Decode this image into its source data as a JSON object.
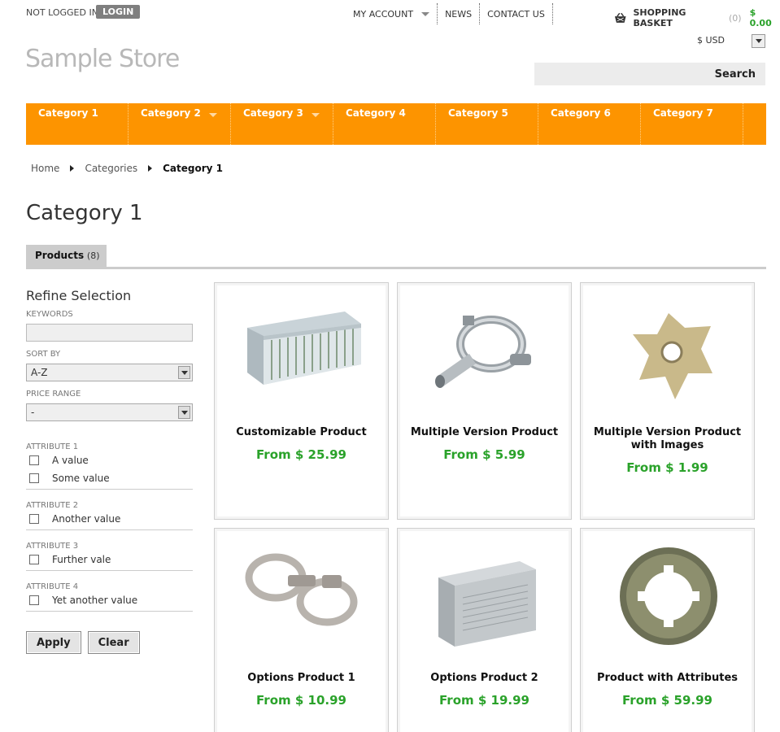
{
  "header": {
    "login_status": "NOT LOGGED IN",
    "login_label": "LOGIN",
    "nav": [
      {
        "label": "MY ACCOUNT"
      },
      {
        "label": "NEWS"
      },
      {
        "label": "CONTACT US"
      }
    ],
    "basket_label": "SHOPPING BASKET",
    "basket_count": "(0)",
    "basket_total": "$ 0.00",
    "currency": "$ USD",
    "logo": "Sample Store",
    "search_label": "Search"
  },
  "categories": [
    "Category 1",
    "Category 2",
    "Category 3",
    "Category 4",
    "Category 5",
    "Category 6",
    "Category 7"
  ],
  "breadcrumb": {
    "home": "Home",
    "categories": "Categories",
    "current": "Category 1"
  },
  "page_title": "Category 1",
  "tab": {
    "label": "Products",
    "count": "(8)"
  },
  "refine": {
    "title": "Refine Selection",
    "keywords_label": "KEYWORDS",
    "keywords_value": "",
    "sort_label": "SORT BY",
    "sort_value": "A-Z",
    "price_label": "PRICE RANGE",
    "price_value": "-",
    "attributes": [
      {
        "name": "ATTRIBUTE 1",
        "options": [
          "A value",
          "Some value"
        ]
      },
      {
        "name": "ATTRIBUTE 2",
        "options": [
          "Another value"
        ]
      },
      {
        "name": "ATTRIBUTE 3",
        "options": [
          "Further vale"
        ]
      },
      {
        "name": "ATTRIBUTE 4",
        "options": [
          "Yet another value"
        ]
      }
    ],
    "apply_label": "Apply",
    "clear_label": "Clear"
  },
  "products": [
    {
      "name": "Customizable Product",
      "price": "From $ 25.99",
      "image": "air-filter"
    },
    {
      "name": "Multiple Version Product",
      "price": "From $ 5.99",
      "image": "pipe-clamp"
    },
    {
      "name": "Multiple Version Product with Images",
      "price": "From $ 1.99",
      "image": "star-washer"
    },
    {
      "name": "Options Product 1",
      "price": "From $ 10.99",
      "image": "handcuffs"
    },
    {
      "name": "Options Product 2",
      "price": "From $ 19.99",
      "image": "metal-cover"
    },
    {
      "name": "Product with Attributes",
      "price": "From $ 59.99",
      "image": "lock-washer"
    }
  ],
  "colors": {
    "accent": "#fd9400",
    "price": "#2aa22a"
  }
}
